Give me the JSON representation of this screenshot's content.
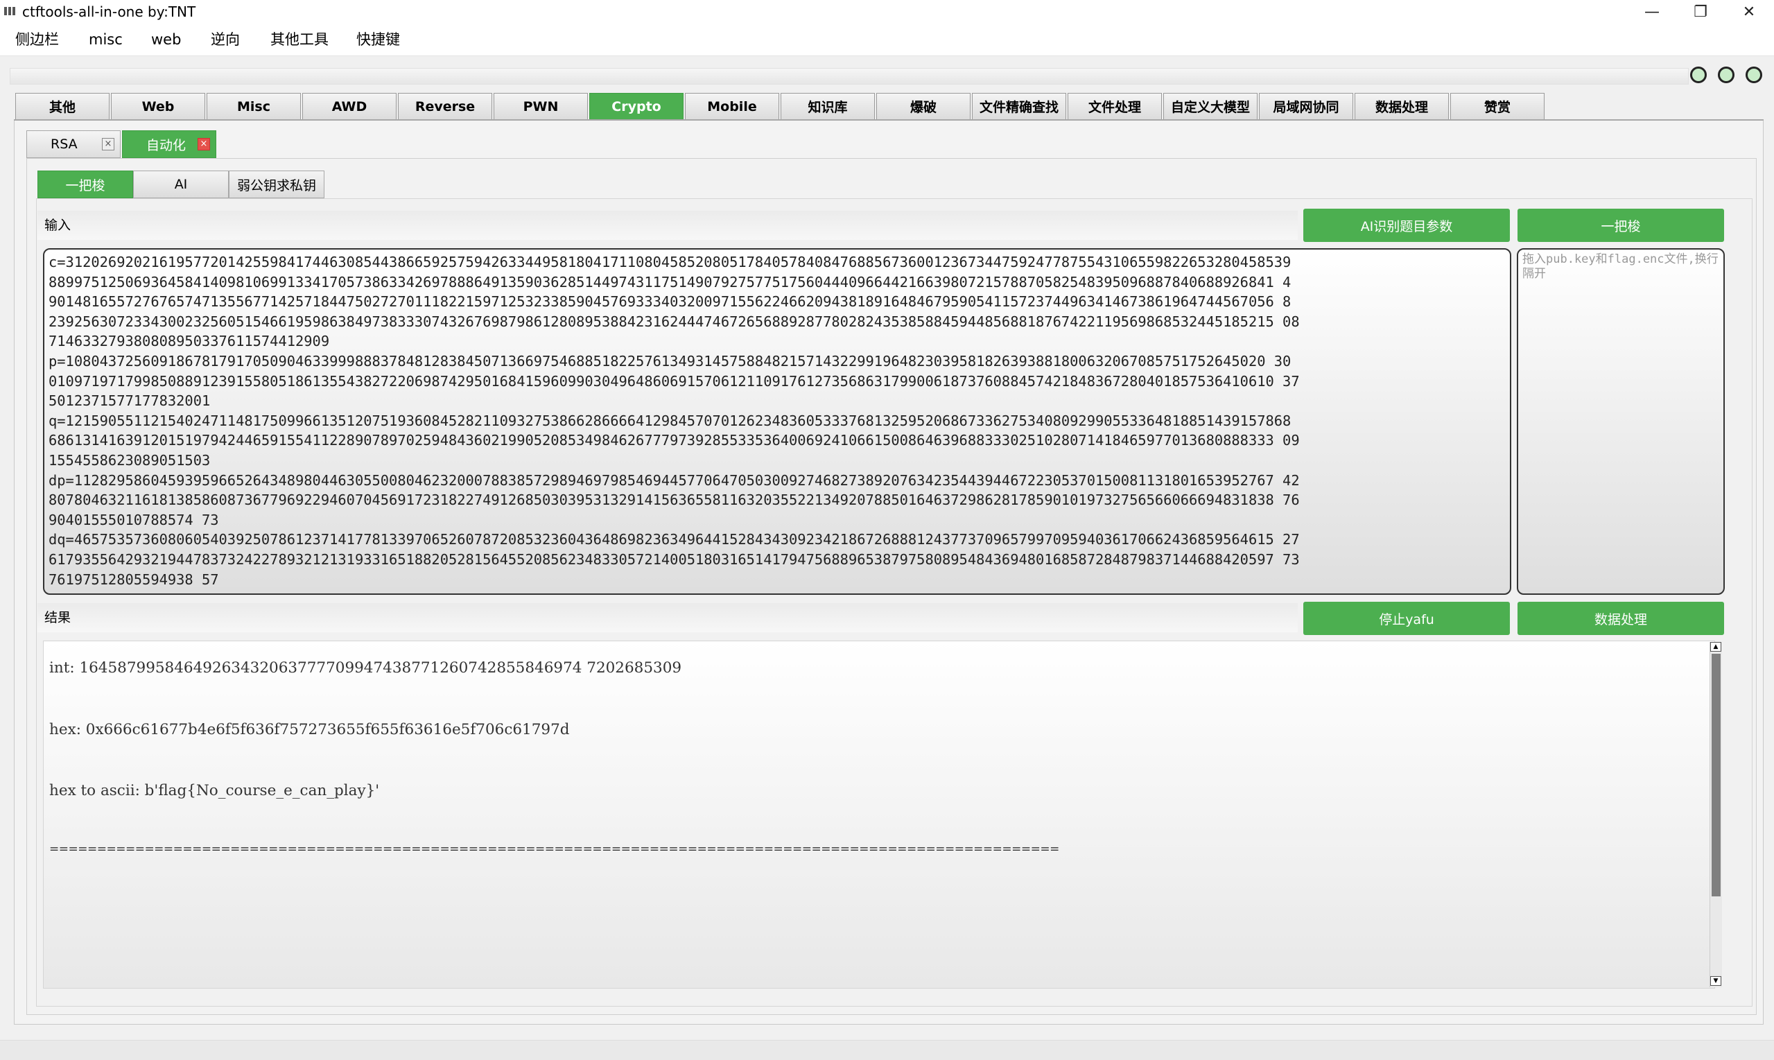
{
  "window": {
    "title": "ctftools-all-in-one   by:TNT",
    "minimize_glyph": "—",
    "maximize_glyph": "❐",
    "close_glyph": "✕"
  },
  "menu": [
    "侧边栏",
    "misc",
    "web",
    "逆向",
    "其他工具",
    "快捷键"
  ],
  "main_tabs": [
    "其他",
    "Web",
    "Misc",
    "AWD",
    "Reverse",
    "PWN",
    "Crypto",
    "Mobile",
    "知识库",
    "爆破",
    "文件精确查找",
    "文件处理",
    "自定义大模型",
    "局域网协同",
    "数据处理",
    "赞赏"
  ],
  "active_main_tab": "Crypto",
  "sub_tabs": [
    {
      "label": "RSA",
      "close": "×"
    },
    {
      "label": "自动化",
      "close": "×"
    }
  ],
  "inner_tabs": [
    "一把梭",
    "AI",
    "弱公钥求私钥"
  ],
  "input_section": {
    "label": "输入",
    "ai_button": "AI识别题目参数",
    "run_button": "一把梭",
    "drop_placeholder": "拖入pub.key和flag.enc文件,换行隔开",
    "lines": [
      "c=312026920216195772014255984174463085443866592575942633449581804171108045852080517840578408476885673600123673447592477875543106559822653280458539",
      "889975125069364584140981069913341705738633426978886491359036285144974311751490792757751756044409664421663980721578870582548395096887840688926841 4",
      "901481655727676574713556771425718447502727011182215971253233859045769333403200971556224662094381891648467959054115723744963414673861964744567056 8",
      "239256307233430023256051546619598638497383330743267698798612808953884231624447467265688928778028243538588459448568818767422119569868532445185215 08",
      "714633279380808950337611574412909",
      "p=108043725609186781791705090463399988837848128384507136697546885182257613493145758848215714322991964823039581826393881800632067085751752645020 30",
      "010971971799850889123915580518613554382722069874295016841596099030496486069157061211091761273568631799006187376088457421848367280401857536410610 37",
      "5012371577177832001",
      "q=121590551121540247114817509966135120751936084528211093275386628666641298457070126234836053337681325952068673362753408092990553364818851439157868",
      "686131416391201519794244659155411228907897025948436021990520853498462677797392855335364006924106615008646396883330251028071418465977013680888333 09",
      "1554558623089051503",
      "dp=112829586045939596652643489804463055008046232000788385729894697985469445770647050300927468273892076342354439446722305370150081131801653952767 42",
      "807804632116181385860873677969229460704569172318227491268503039531329141563655811632035522134920788501646372986281785901019732756566066694831838 76",
      "90401555010788574 73",
      "dq=465753573608060540392507861237141778133970652607872085323604364869823634964415284343092342186726888124377370965799709594036170662436859564615 27",
      "617935564293219447837324227893212131933165188205281564552085623483305721400518031651417947568896538797580895484369480168587284879837144688420597 73",
      "76197512805594938 57"
    ]
  },
  "result_section": {
    "label": "结果",
    "stop_button": "停止yafu",
    "data_button": "数据处理",
    "lines": [
      "int: 16458799584649263432063777709947438771260742855846974 7202685309",
      "hex: 0x666c61677b4e6f5f636f757273655f655f63616e5f706c61797d",
      "hex to ascii: b'flag{No_course_e_can_play}'",
      "=========================================================================================================="
    ]
  },
  "scroll_up": "▲",
  "scroll_down": "▼"
}
